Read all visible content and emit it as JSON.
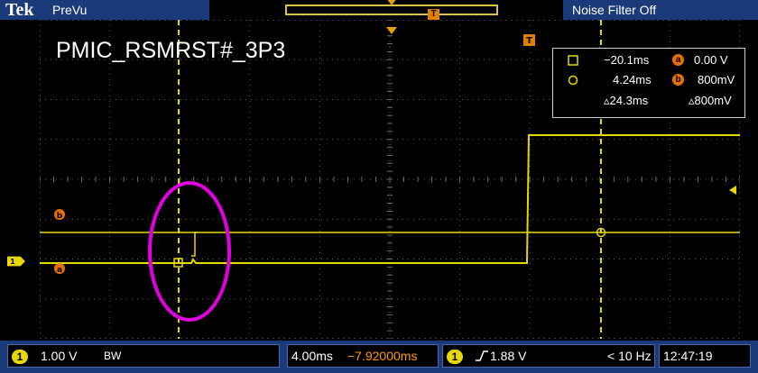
{
  "top_bar": {
    "brand": "Tek",
    "mode": "PreVu",
    "noise_filter": "Noise Filter Off"
  },
  "waveform": {
    "label": "PMIC_RSMRST#_3P3"
  },
  "cursor_readout": {
    "cursor_a_time": "−20.1ms",
    "cursor_a_volt": "0.00 V",
    "cursor_b_time": "4.24ms",
    "cursor_b_volt": "800mV",
    "delta_time": "▵24.3ms",
    "delta_volt": "▵800mV",
    "cursor_a_tag": "a",
    "cursor_b_tag": "b"
  },
  "markers": {
    "channel": "1",
    "ref_b": "b",
    "ref_a": "a"
  },
  "bottom_bar": {
    "channel": "1",
    "volts_per_div": "1.00 V",
    "bandwidth": "BW",
    "time_per_div": "4.00ms",
    "delay": "−7.92000ms",
    "trigger_channel": "1",
    "trigger_level": "1.88 V",
    "trigger_freq": "< 10 Hz",
    "clock": "12:47:19"
  },
  "colors": {
    "trace": "#e6d800",
    "cursor": "#e6d800",
    "accent": "#ff9a00",
    "highlight": "#e000e0",
    "frame": "#1a3a7a"
  }
}
